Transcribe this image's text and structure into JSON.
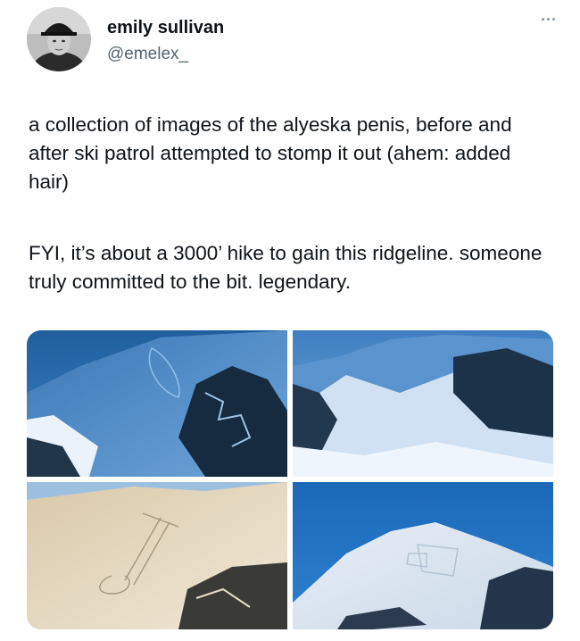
{
  "user": {
    "display_name": "emily sullivan",
    "handle": "@emelex_"
  },
  "tweet": {
    "paragraph_1": "a collection of images of the alyeska penis, before and after ski patrol attempted to stomp it out (ahem: added hair)",
    "paragraph_2": "FYI, it’s about a 3000’ hike to gain this ridgeline. someone truly committed to the bit. legendary."
  },
  "icons": {
    "more": "more-options-icon"
  },
  "colors": {
    "text": "#0f1419",
    "secondary": "#536471"
  }
}
